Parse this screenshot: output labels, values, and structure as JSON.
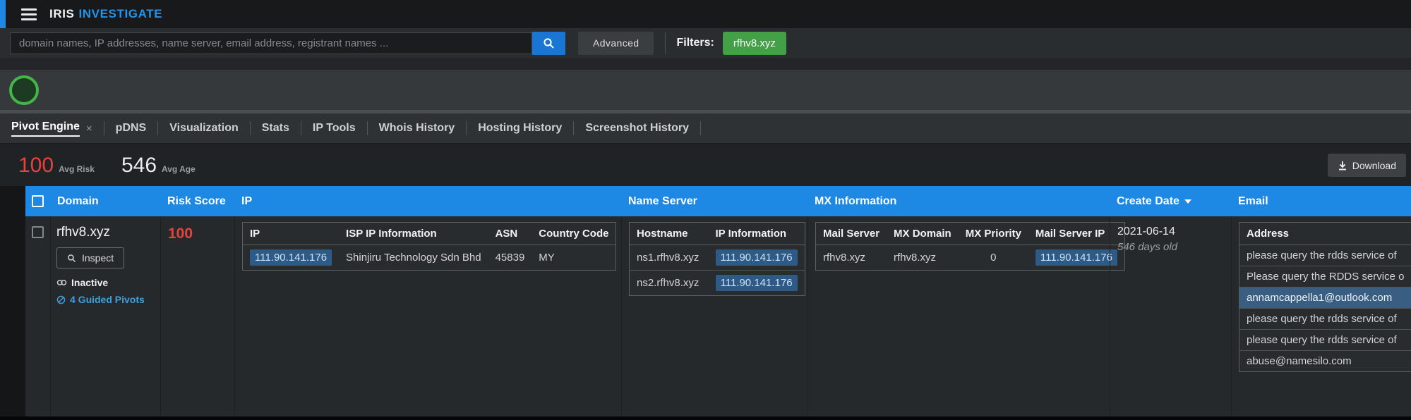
{
  "topbar": {
    "brand_primary": "IRIS",
    "brand_secondary": "INVESTIGATE"
  },
  "search": {
    "placeholder": "domain names, IP addresses, name server, email address, registrant names ...",
    "advanced_label": "Advanced",
    "filters_label": "Filters:",
    "filter_chip": "rfhv8.xyz"
  },
  "tabs": [
    {
      "label": "Pivot Engine",
      "close": "×"
    },
    {
      "label": "pDNS"
    },
    {
      "label": "Visualization"
    },
    {
      "label": "Stats"
    },
    {
      "label": "IP Tools"
    },
    {
      "label": "Whois History"
    },
    {
      "label": "Hosting History"
    },
    {
      "label": "Screenshot History"
    }
  ],
  "stats": {
    "avg_risk_value": "100",
    "avg_risk_label": "Avg Risk",
    "avg_age_value": "546",
    "avg_age_label": "Avg Age",
    "download_label": "Download"
  },
  "table": {
    "headers": {
      "domain": "Domain",
      "risk_score": "Risk Score",
      "ip": "IP",
      "name_server": "Name Server",
      "mx": "MX Information",
      "create_date": "Create Date",
      "email": "Email"
    },
    "row": {
      "domain": "rfhv8.xyz",
      "inspect_label": "Inspect",
      "status": "Inactive",
      "guided_pivots": "4 Guided Pivots",
      "risk_score": "100",
      "ip_table": {
        "headers": [
          "IP",
          "ISP IP Information",
          "ASN",
          "Country Code"
        ],
        "rows": [
          {
            "ip": "111.90.141.176",
            "isp": "Shinjiru Technology Sdn Bhd",
            "asn": "45839",
            "country_code": "MY"
          }
        ]
      },
      "ns_table": {
        "headers": [
          "Hostname",
          "IP Information"
        ],
        "rows": [
          {
            "hostname": "ns1.rfhv8.xyz",
            "ip": "111.90.141.176"
          },
          {
            "hostname": "ns2.rfhv8.xyz",
            "ip": "111.90.141.176"
          }
        ]
      },
      "mx_table": {
        "headers": [
          "Mail Server",
          "MX Domain",
          "MX Priority",
          "Mail Server IP"
        ],
        "rows": [
          {
            "mail_server": "rfhv8.xyz",
            "mx_domain": "rfhv8.xyz",
            "priority": "0",
            "ip": "111.90.141.176"
          }
        ]
      },
      "create_date": "2021-06-14",
      "age": "546 days old",
      "email_table": {
        "header": "Address",
        "rows": [
          {
            "text": "please query the rdds service of"
          },
          {
            "text": "Please query the RDDS service o"
          },
          {
            "text": "annamcappella1@outlook.com"
          },
          {
            "text": "please query the rdds service of"
          },
          {
            "text": "please query the rdds service of"
          },
          {
            "text": "abuse@namesilo.com"
          }
        ]
      }
    }
  },
  "colors": {
    "accent_blue": "#1e88e5",
    "risk_red": "#e8423d",
    "filter_green": "#43a047",
    "highlight_blue": "#2e5a87",
    "status_ring_green": "#43b649"
  }
}
